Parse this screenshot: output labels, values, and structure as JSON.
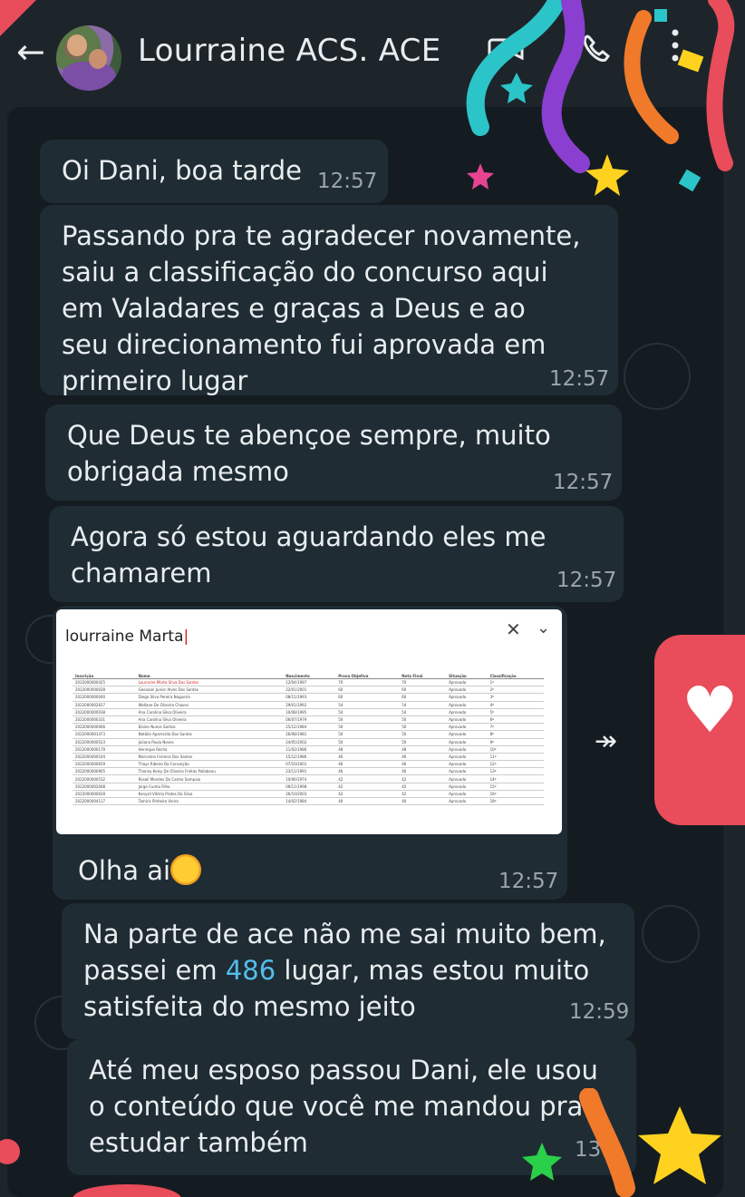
{
  "header": {
    "back_icon": "arrow-left-icon",
    "contact_name": "Lourraine ACS. ACE",
    "video_icon": "video-call-icon",
    "phone_icon": "phone-icon",
    "menu_icon": "more-vert-icon"
  },
  "messages": [
    {
      "text": "Oi Dani, boa tarde",
      "time": "12:57"
    },
    {
      "text": "Passando pra te agradecer novamente,\nsaiu a classificação do concurso aqui\nem Valadares e graças a Deus e ao\nseu direcionamento fui aprovada em\nprimeiro lugar",
      "time": "12:57"
    },
    {
      "text": "Que Deus te abençoe sempre, muito\nobrigada mesmo",
      "time": "12:57"
    },
    {
      "text": "Agora só estou aguardando eles me\nchamarem",
      "time": "12:57"
    },
    {
      "text": "Olha ai",
      "time": "12:57"
    },
    {
      "text_before": "Na parte de ace não me sai muito bem,\npassei em ",
      "highlight": "486",
      "text_after": " lugar, mas estou muito\nsatisfeita do mesmo jeito",
      "time": "12:59"
    },
    {
      "text": "Até meu esposo passou Dani, ele usou\no conteúdo que você me mandou pra\nestudar também",
      "time": "13:"
    }
  ],
  "media": {
    "search_text": "lourraine Marta",
    "close_icon": "close-icon",
    "chevron_icon": "chevron-down-icon",
    "columns": [
      "Inscrição",
      "Nome",
      "Nascimento",
      "Prova Objetiva",
      "Nota Final",
      "Situação",
      "Classificação"
    ],
    "rows": [
      [
        "2022000000425",
        "Lourraine Marta Silva Dos Santos",
        "12/04/1997",
        "70",
        "70",
        "Aprovado",
        "1º"
      ],
      [
        "2022000000028",
        "Geovaan Junior Alves Dos Santos",
        "22/01/2001",
        "60",
        "60",
        "Aprovado",
        "2º"
      ],
      [
        "2022000000040",
        "Diego Silva Pereira Nogueira",
        "08/11/1993",
        "60",
        "60",
        "Aprovado",
        "3º"
      ],
      [
        "2022000002817",
        "Wellane De Oliveira Chaves",
        "29/01/1992",
        "54",
        "54",
        "Aprovado",
        "4º"
      ],
      [
        "2022000000038",
        "Ana Carolina Silva Oliveira",
        "10/08/1995",
        "54",
        "54",
        "Aprovado",
        "5º"
      ],
      [
        "2022000000331",
        "Ana Carolina Silva Oliveira",
        "06/07/1979",
        "50",
        "50",
        "Aprovado",
        "6º"
      ],
      [
        "2022000000066",
        "Elaine Nunes Santos",
        "25/12/1984",
        "50",
        "50",
        "Aprovado",
        "7º"
      ],
      [
        "2022000001473",
        "Natália Aparecida Dos Santos",
        "26/08/1981",
        "50",
        "50",
        "Aprovado",
        "8º"
      ],
      [
        "2022000000523",
        "Juliana Paula Neves",
        "24/05/2002",
        "50",
        "50",
        "Aprovado",
        "9º"
      ],
      [
        "2022000000179",
        "Henrique Rocha",
        "11/02/1986",
        "48",
        "48",
        "Aprovado",
        "10º"
      ],
      [
        "2022000000104",
        "Marcelino Ferreira Dos Santos",
        "15/12/1986",
        "46",
        "46",
        "Aprovado",
        "11º"
      ],
      [
        "2022000000659",
        "Thays Ribeiro Da Conceição",
        "07/10/2001",
        "46",
        "46",
        "Aprovado",
        "12º"
      ],
      [
        "2022000000905",
        "Thanny Keisy De Oliveira Freitas Pallabeau",
        "23/11/1991",
        "46",
        "46",
        "Aprovado",
        "13º"
      ],
      [
        "2022000000532",
        "Rosali Mendes Do Carmo Sampaio",
        "10/06/1974",
        "42",
        "42",
        "Aprovado",
        "14º"
      ],
      [
        "2022000002008",
        "Jorge Cunha Filho",
        "09/11/1998",
        "42",
        "42",
        "Aprovado",
        "15º"
      ],
      [
        "2022000000628",
        "Kenysll Vitória Prates Da Silva",
        "26/10/2003",
        "42",
        "42",
        "Aprovado",
        "16º"
      ],
      [
        "2022000004117",
        "Tamiris Pinheiro Vieira",
        "14/02/1984",
        "40",
        "40",
        "Aprovado",
        "18º"
      ]
    ]
  },
  "decor": {
    "heart_icon": "heart-icon",
    "forward_icon": "forward-icon",
    "accent_colors": [
      "#2bc4c8",
      "#8a3fd0",
      "#f07a2a",
      "#e94c5a",
      "#ffd21f"
    ]
  }
}
